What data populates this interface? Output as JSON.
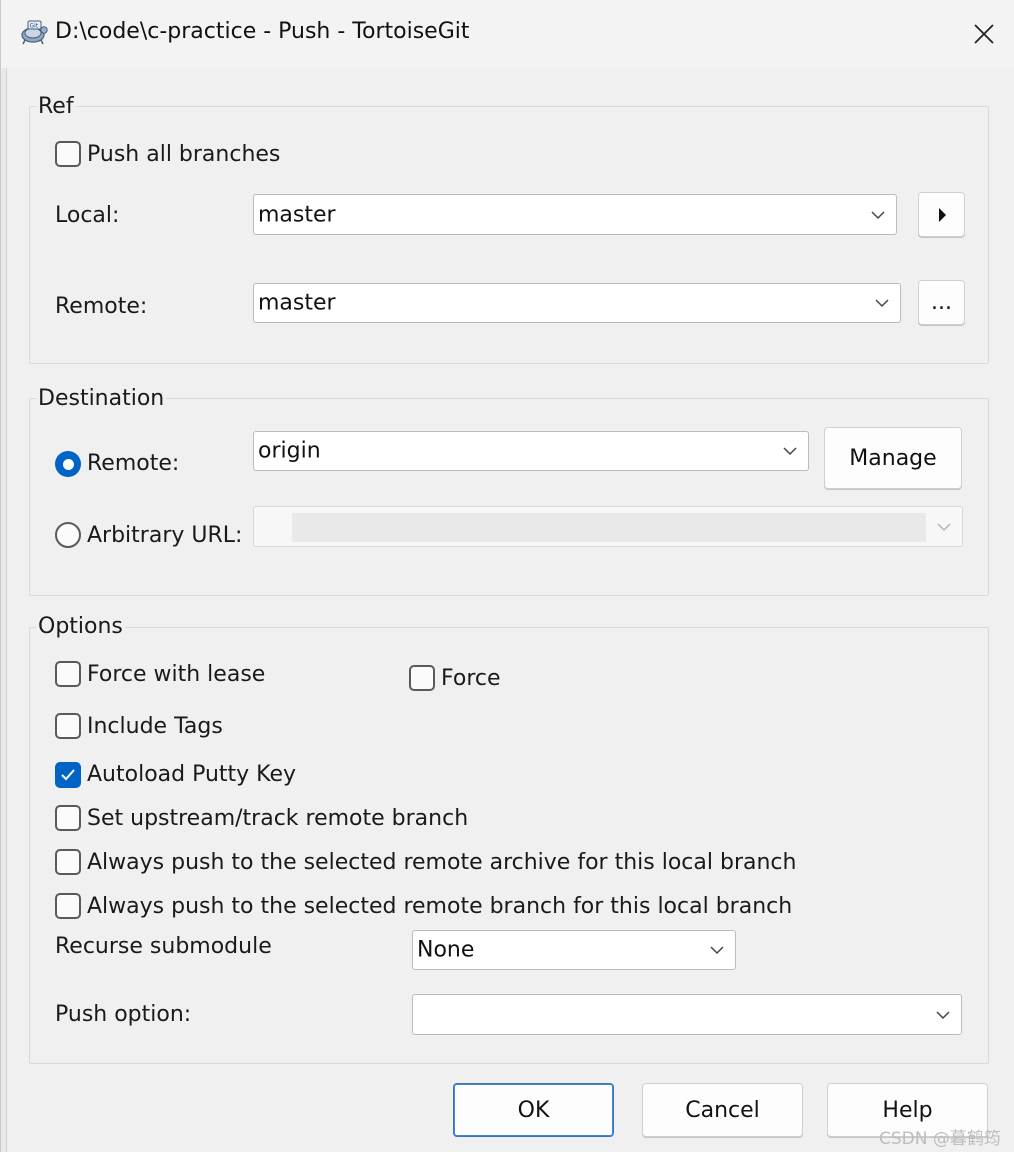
{
  "window": {
    "title": "D:\\code\\c-practice - Push - TortoiseGit",
    "close_label": "close"
  },
  "ref": {
    "group_label": "Ref",
    "push_all_branches": {
      "label": "Push all branches",
      "checked": false
    },
    "local": {
      "label": "Local:",
      "value": "master"
    },
    "local_menu_button": "▸",
    "remote": {
      "label": "Remote:",
      "value": "master"
    },
    "remote_browse_button": "..."
  },
  "destination": {
    "group_label": "Destination",
    "remote_radio": {
      "label": "Remote:",
      "selected": true,
      "value": "origin"
    },
    "manage_button": "Manage",
    "arbitrary_url_radio": {
      "label": "Arbitrary URL:",
      "selected": false,
      "value": ""
    }
  },
  "options": {
    "group_label": "Options",
    "force_with_lease": {
      "label": "Force with lease",
      "checked": false
    },
    "force": {
      "label": "Force",
      "checked": false
    },
    "include_tags": {
      "label": "Include Tags",
      "checked": false
    },
    "autoload_putty_key": {
      "label": "Autoload Putty Key",
      "checked": true
    },
    "set_upstream": {
      "label": "Set upstream/track remote branch",
      "checked": false
    },
    "always_push_archive": {
      "label": "Always push to the selected remote archive for this local branch",
      "checked": false
    },
    "always_push_branch": {
      "label": "Always push to the selected remote branch for this local branch",
      "checked": false
    },
    "recurse_submodule": {
      "label": "Recurse submodule",
      "value": "None"
    },
    "push_option": {
      "label": "Push option:",
      "value": ""
    }
  },
  "footer": {
    "ok_button": "OK",
    "cancel_button": "Cancel",
    "help_button": "Help"
  },
  "watermark": "CSDN @暮鹤筠",
  "colors": {
    "accent": "#0063c6",
    "background": "#f0f0f0"
  }
}
